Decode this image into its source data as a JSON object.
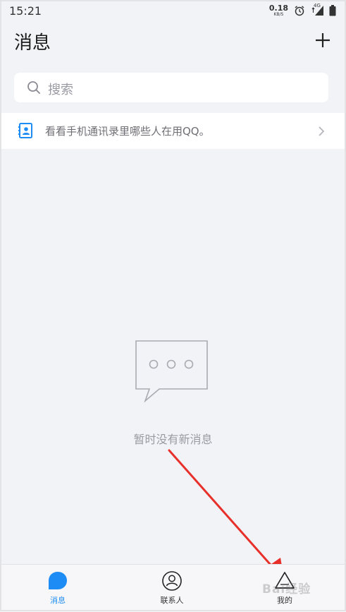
{
  "status_bar": {
    "time": "15:21",
    "net_speed_value": "0.18",
    "net_speed_unit": "KB/S",
    "network_type": "4G",
    "icons": [
      "alarm-icon",
      "signal-icon",
      "battery-icon"
    ]
  },
  "header": {
    "title": "消息",
    "add_icon": "plus-icon"
  },
  "search": {
    "placeholder": "搜索",
    "icon": "search-icon"
  },
  "contact_banner": {
    "text": "看看手机通讯录里哪些人在用QQ。",
    "icon": "contact-book-icon"
  },
  "empty_state": {
    "message": "暂时没有新消息",
    "icon": "chat-bubble-icon"
  },
  "tab_bar": {
    "tabs": [
      {
        "label": "消息",
        "icon": "message-bubble-icon",
        "active": true
      },
      {
        "label": "联系人",
        "icon": "contact-person-icon",
        "active": false
      },
      {
        "label": "我的",
        "icon": "triangle-me-icon",
        "active": false
      }
    ]
  },
  "watermark": {
    "text": "Bai经验"
  },
  "colors": {
    "accent": "#1d8cf5",
    "background": "#f2f3f7",
    "annotation": "#e8302a"
  }
}
